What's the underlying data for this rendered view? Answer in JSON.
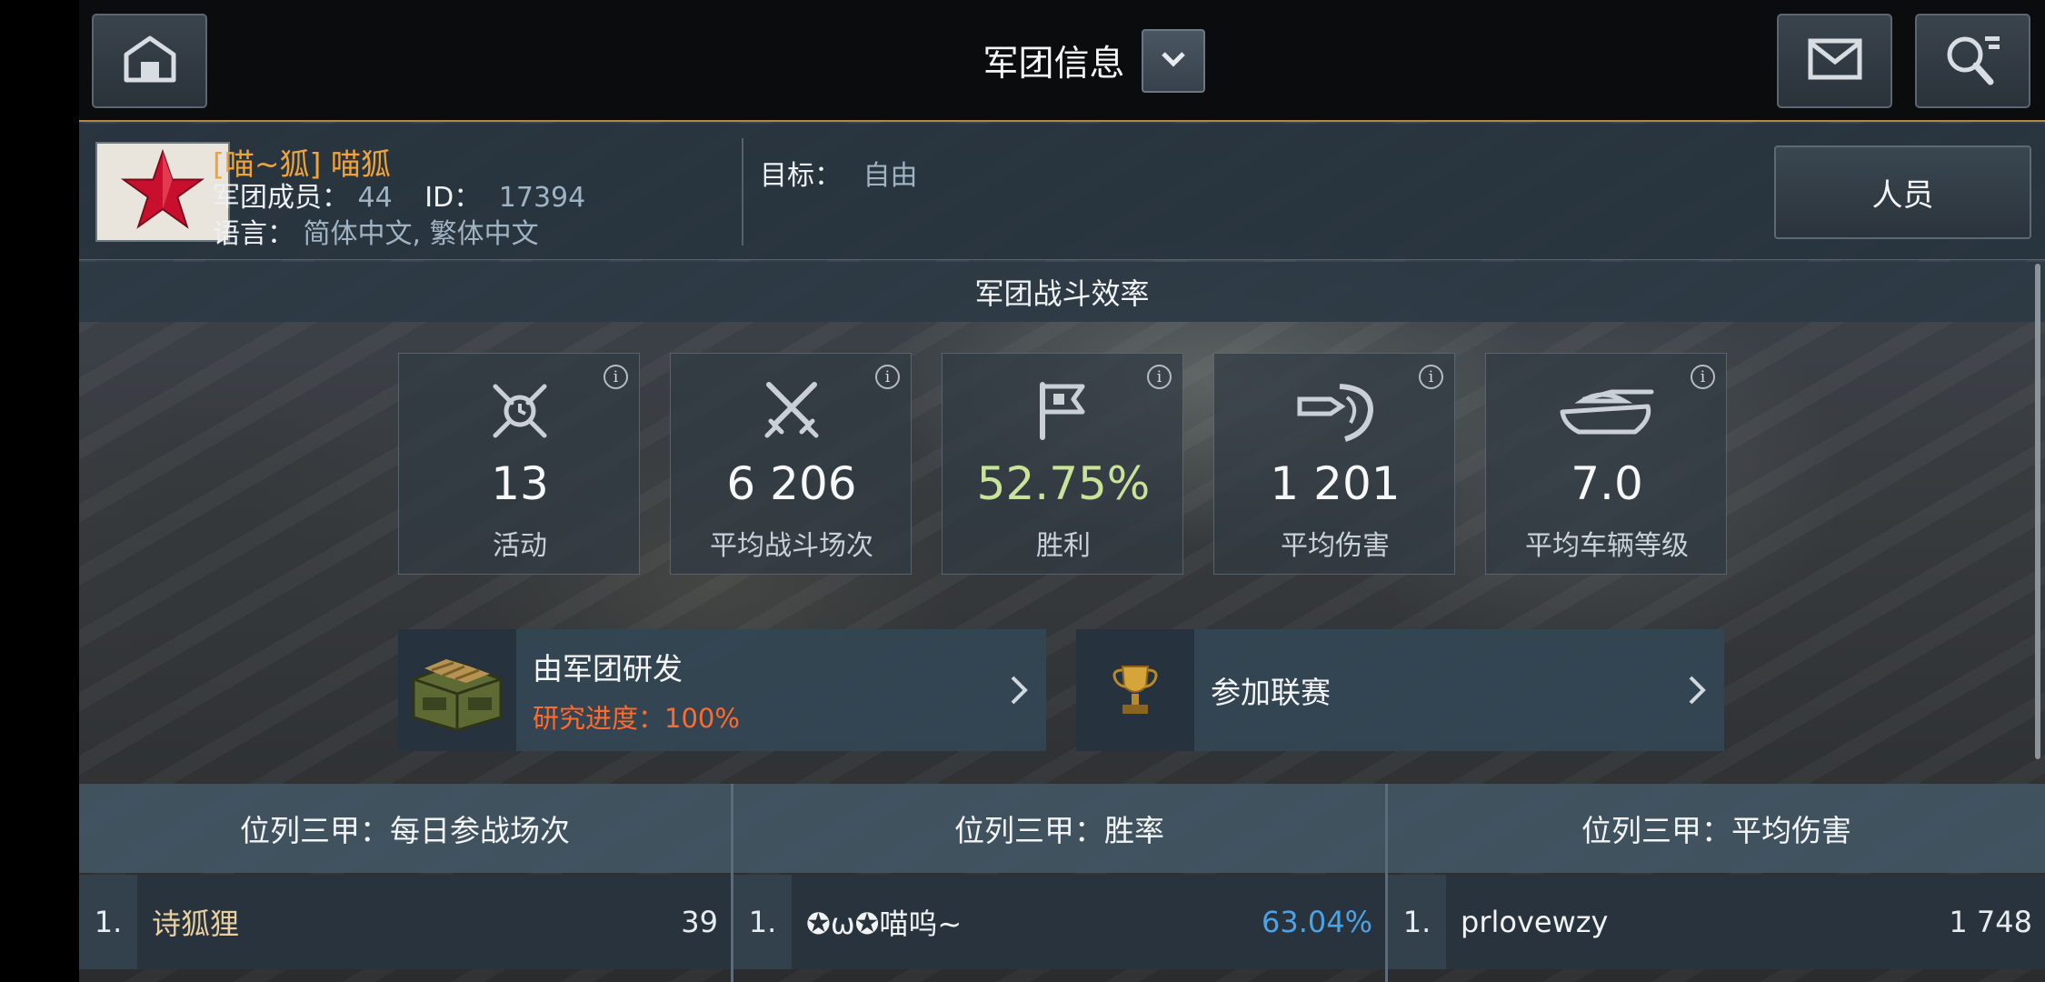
{
  "header": {
    "title": "军团信息"
  },
  "clan": {
    "name": "[喵~狐] 喵狐",
    "members_label": "军团成员：",
    "members_value": "44",
    "id_label": "ID：",
    "id_value": "17394",
    "language_label": "语言：",
    "language_value": "简体中文, 繁体中文",
    "goal_label": "目标：",
    "goal_value": "自由",
    "staff_button": "人员"
  },
  "section": {
    "title": "军团战斗效率"
  },
  "stats": [
    {
      "value": "13",
      "label": "活动",
      "icon": "clock-swords-icon"
    },
    {
      "value": "6 206",
      "label": "平均战斗场次",
      "icon": "crossed-swords-icon"
    },
    {
      "value": "52.75%",
      "label": "胜利",
      "icon": "flag-icon"
    },
    {
      "value": "1 201",
      "label": "平均伤害",
      "icon": "shell-shield-icon"
    },
    {
      "value": "7.0",
      "label": "平均车辆等级",
      "icon": "tank-icon"
    }
  ],
  "research": {
    "title": "由军团研发",
    "progress_label": "研究进度：100%"
  },
  "league": {
    "title": "参加联赛"
  },
  "rankings": [
    {
      "header": "位列三甲：每日参战场次",
      "rank": "1.",
      "name": "诗狐狸",
      "score": "39"
    },
    {
      "header": "位列三甲：胜率",
      "rank": "1.",
      "name": "✪ω✪喵呜~",
      "score": "63.04%"
    },
    {
      "header": "位列三甲：平均伤害",
      "rank": "1.",
      "name": "prlovewzy",
      "score": "1 748"
    }
  ],
  "colors": {
    "clan_name": "#f0a33a",
    "win_rate": "#c9e39a",
    "progress": "#ff6a2e",
    "highlight_score": "#4aa3e8",
    "top_name_gold": "#e8cfa0"
  }
}
